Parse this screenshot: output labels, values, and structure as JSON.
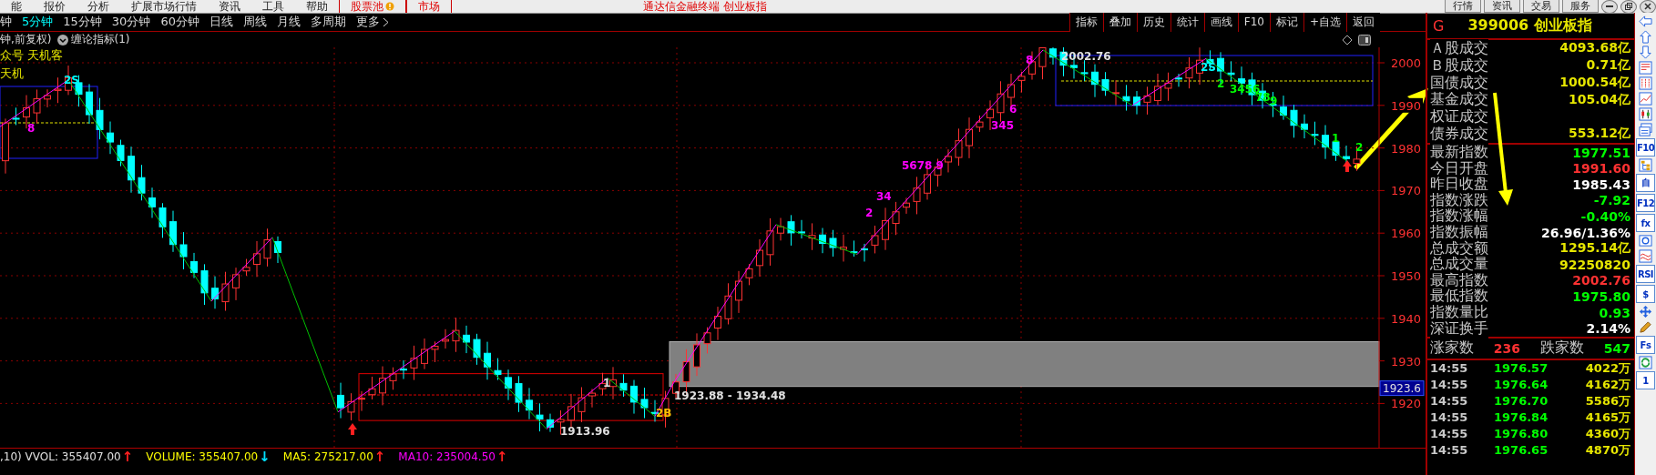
{
  "menu_bar": {
    "items": [
      {
        "label": "能",
        "kind": "plain"
      },
      {
        "label": "报价",
        "kind": "plain"
      },
      {
        "label": "分析",
        "kind": "plain"
      },
      {
        "label": "扩展市场行情",
        "kind": "plain"
      },
      {
        "label": "资讯",
        "kind": "plain"
      },
      {
        "label": "工具",
        "kind": "plain"
      },
      {
        "label": "帮助",
        "kind": "plain"
      },
      {
        "label": "股票池",
        "kind": "alert"
      },
      {
        "label": "市场",
        "kind": "highlight"
      }
    ],
    "title": "通达信金融终端 创业板指",
    "service_buttons": [
      "行情",
      "资讯",
      "交易",
      "服务"
    ]
  },
  "periods": [
    {
      "label": "钟",
      "selected": false
    },
    {
      "label": "5分钟",
      "selected": true
    },
    {
      "label": "15分钟",
      "selected": false
    },
    {
      "label": "30分钟",
      "selected": false
    },
    {
      "label": "60分钟",
      "selected": false
    },
    {
      "label": "日线",
      "selected": false
    },
    {
      "label": "周线",
      "selected": false
    },
    {
      "label": "月线",
      "selected": false
    },
    {
      "label": "多周期",
      "selected": false
    }
  ],
  "more_label": "更多",
  "chart_tools": [
    "指标",
    "叠加",
    "历史",
    "统计",
    "画线",
    "F10",
    "标记",
    "+自选",
    "返回"
  ],
  "chart_header": {
    "mode": "钟,前复权)",
    "indicator": "缠论指标(1)"
  },
  "overlay_lines": [
    "众号 天机客",
    "天机"
  ],
  "y_axis": [
    "2000",
    "1990",
    "1980",
    "1970",
    "1960",
    "1950",
    "1940",
    "1930",
    "1920"
  ],
  "price_marker": "1923.6",
  "annotations": [
    {
      "text": "2S",
      "color": "#00ffff"
    },
    {
      "text": "8",
      "color": "#ff00ff"
    },
    {
      "text": "2002.76",
      "color": "#e0e0e0"
    },
    {
      "text": "2S",
      "color": "#00ffff"
    },
    {
      "text": "1913.96",
      "color": "#e0e0e0"
    },
    {
      "text": "1923.88 - 1934.48",
      "color": "#e0e0e0"
    },
    {
      "text": "2B",
      "color": "#ffc000"
    },
    {
      "text": "1",
      "color": "#e0e0e0"
    },
    {
      "text": "2",
      "color": "#ff00ff"
    },
    {
      "text": "34",
      "color": "#ff00ff"
    },
    {
      "text": "5678 9",
      "color": "#ff00ff"
    },
    {
      "text": "345",
      "color": "#ff00ff"
    },
    {
      "text": "6",
      "color": "#ff00ff"
    },
    {
      "text": "8",
      "color": "#ff00ff"
    },
    {
      "text": "2",
      "color": "#00ff00"
    },
    {
      "text": "3456",
      "color": "#00ff00"
    },
    {
      "text": "78",
      "color": "#00ff00"
    },
    {
      "text": "9",
      "color": "#00ff00"
    },
    {
      "text": "1",
      "color": "#00ff00"
    },
    {
      "text": "2",
      "color": "#00ff00"
    }
  ],
  "indicator_line": [
    {
      "label": ",10) VVOL: 355407.00",
      "arrow": {
        "symbol": "↑",
        "color": "#ff2020"
      },
      "color": "#e0e0e0"
    },
    {
      "label": "VOLUME: 355407.00",
      "arrow": {
        "symbol": "↓",
        "color": "#00e0ff"
      },
      "color": "#ffff00"
    },
    {
      "label": "MA5: 275217.00",
      "arrow": {
        "symbol": "↑",
        "color": "#ff2020"
      },
      "color": "#ffff00"
    },
    {
      "label": "MA10: 235004.50",
      "arrow": {
        "symbol": "↑",
        "color": "#ff2020"
      },
      "color": "#ff00ff"
    }
  ],
  "quote": {
    "flag": "G",
    "code": "399006",
    "name": "创业板指"
  },
  "volume_stats": [
    {
      "label": "Ａ股成交",
      "value": "4093.68亿"
    },
    {
      "label": "Ｂ股成交",
      "value": "0.71亿"
    },
    {
      "label": "国债成交",
      "value": "1000.54亿"
    },
    {
      "label": "基金成交",
      "value": "105.04亿"
    },
    {
      "label": "权证成交"
    },
    {
      "label": "债券成交",
      "value": "553.12亿"
    }
  ],
  "index_stats": [
    {
      "label": "最新指数",
      "value": "1977.51",
      "color": "#00ff00"
    },
    {
      "label": "今日开盘",
      "value": "1991.60",
      "color": "#ff3232"
    },
    {
      "label": "昨日收盘",
      "value": "1985.43",
      "color": "#ffffff"
    },
    {
      "label": "指数涨跌",
      "value": "-7.92",
      "color": "#00ff00"
    },
    {
      "label": "指数涨幅",
      "value": "-0.40%",
      "color": "#00ff00"
    },
    {
      "label": "指数振幅",
      "value": "26.96/1.36%",
      "color": "#ffffff"
    },
    {
      "label": "总成交额",
      "value": "1295.14亿",
      "color": "#e6e600"
    },
    {
      "label": "总成交量",
      "value": "92250820",
      "color": "#e6e600"
    },
    {
      "label": "最高指数",
      "value": "2002.76",
      "color": "#ff3232"
    },
    {
      "label": "最低指数",
      "value": "1975.80",
      "color": "#00ff00"
    },
    {
      "label": "指数量比",
      "value": "0.93",
      "color": "#00ff00"
    },
    {
      "label": "深证换手",
      "value": "2.14%",
      "color": "#ffffff"
    }
  ],
  "breadth": {
    "up_label": "涨家数",
    "up": "236",
    "down_label": "跌家数",
    "down": "547"
  },
  "ticks": [
    {
      "time": "14:55",
      "price": "1976.57",
      "volume": "4022万"
    },
    {
      "time": "14:55",
      "price": "1976.64",
      "volume": "4162万"
    },
    {
      "time": "14:55",
      "price": "1976.70",
      "volume": "5586万"
    },
    {
      "time": "14:55",
      "price": "1976.84",
      "volume": "4165万"
    },
    {
      "time": "14:55",
      "price": "1976.80",
      "volume": "4360万"
    },
    {
      "time": "14:55",
      "price": "1976.65",
      "volume": "4870万"
    }
  ],
  "side_toolbar": [
    {
      "kind": "arrow-left"
    },
    {
      "kind": "arrow-up"
    },
    {
      "kind": "arrow-down"
    },
    {
      "kind": "table"
    },
    {
      "kind": "grid"
    },
    {
      "kind": "line"
    },
    {
      "kind": "candle"
    },
    {
      "kind": "window"
    },
    {
      "kind": "label",
      "label": "F10"
    },
    {
      "kind": "tree"
    },
    {
      "kind": "label",
      "label": "自"
    },
    {
      "kind": "label",
      "label": "F12"
    },
    {
      "kind": "label",
      "label": "fx"
    },
    {
      "kind": "circle"
    },
    {
      "kind": "wave"
    },
    {
      "kind": "label",
      "label": "RSI"
    },
    {
      "kind": "label",
      "label": "$"
    },
    {
      "kind": "move"
    },
    {
      "kind": "pencil"
    },
    {
      "kind": "label",
      "label": "Fs"
    },
    {
      "kind": "refresh"
    },
    {
      "kind": "label",
      "label": "1"
    }
  ]
}
